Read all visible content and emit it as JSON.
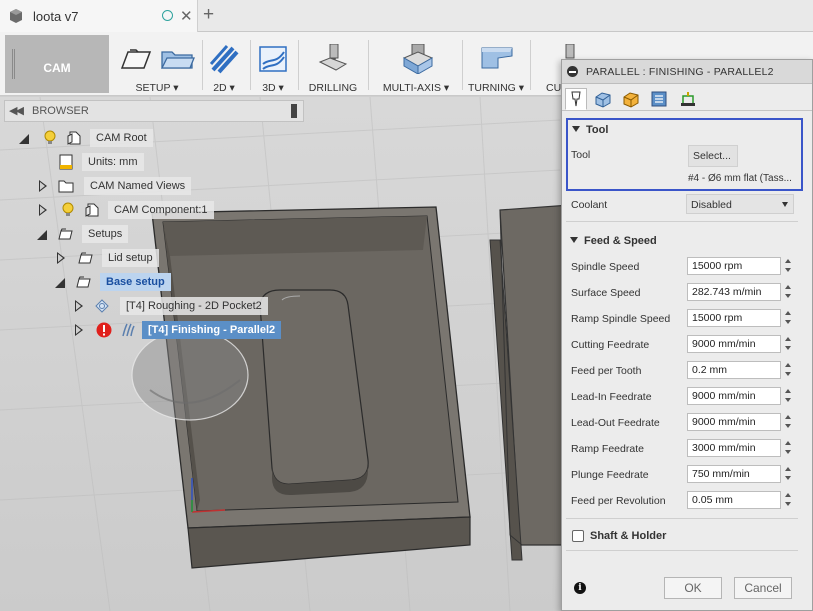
{
  "window": {
    "tab_title": "loota v7",
    "doc_icon": "document-cube-icon",
    "sync_icon": "sync-status-icon",
    "close_glyph": "✕",
    "new_tab_glyph": "+"
  },
  "toolbar": {
    "workspace": "CAM",
    "groups": [
      {
        "label": "SETUP ▾",
        "icon": "setup-icon"
      },
      {
        "label": "2D ▾",
        "icon": "2d-icon"
      },
      {
        "label": "3D ▾",
        "icon": "3d-icon"
      },
      {
        "label": "DRILLING",
        "icon": "drilling-icon"
      },
      {
        "label": "MULTI-AXIS ▾",
        "icon": "multi-axis-icon"
      },
      {
        "label": "TURNING ▾",
        "icon": "turning-icon"
      },
      {
        "label": "CU",
        "icon": "cutting-icon"
      }
    ]
  },
  "browser": {
    "title": "BROWSER",
    "nodes": [
      {
        "label": "CAM Root"
      },
      {
        "label": "Units: mm"
      },
      {
        "label": "CAM Named Views"
      },
      {
        "label": "CAM Component:1"
      },
      {
        "label": "Setups"
      },
      {
        "label": "Lid setup"
      },
      {
        "label": "Base setup"
      },
      {
        "label": "[T4] Roughing - 2D Pocket2"
      },
      {
        "label": "[T4] Finishing - Parallel2"
      }
    ]
  },
  "dialog": {
    "title": "PARALLEL : FINISHING - PARALLEL2",
    "tool_section": {
      "heading": "Tool",
      "tool_label": "Tool",
      "select_label": "Select...",
      "tool_description": "#4 - Ø6 mm flat (Tass..."
    },
    "coolant": {
      "label": "Coolant",
      "value": "Disabled"
    },
    "feed_section": {
      "heading": "Feed & Speed",
      "rows": [
        {
          "label": "Spindle Speed",
          "value": "15000 rpm"
        },
        {
          "label": "Surface Speed",
          "value": "282.743 m/min"
        },
        {
          "label": "Ramp Spindle Speed",
          "value": "15000 rpm"
        },
        {
          "label": "Cutting Feedrate",
          "value": "9000 mm/min"
        },
        {
          "label": "Feed per Tooth",
          "value": "0.2 mm"
        },
        {
          "label": "Lead-In Feedrate",
          "value": "9000 mm/min"
        },
        {
          "label": "Lead-Out Feedrate",
          "value": "9000 mm/min"
        },
        {
          "label": "Ramp Feedrate",
          "value": "3000 mm/min"
        },
        {
          "label": "Plunge Feedrate",
          "value": "750 mm/min"
        },
        {
          "label": "Feed per Revolution",
          "value": "0.05 mm"
        }
      ]
    },
    "shaft_section": {
      "heading": "Shaft & Holder"
    },
    "footer": {
      "info_glyph": "i",
      "ok_label": "OK",
      "cancel_label": "Cancel"
    }
  },
  "colors": {
    "highlight_blue": "#3a55c9",
    "active_node": "#5b8fc7",
    "error_red": "#e0201c"
  }
}
